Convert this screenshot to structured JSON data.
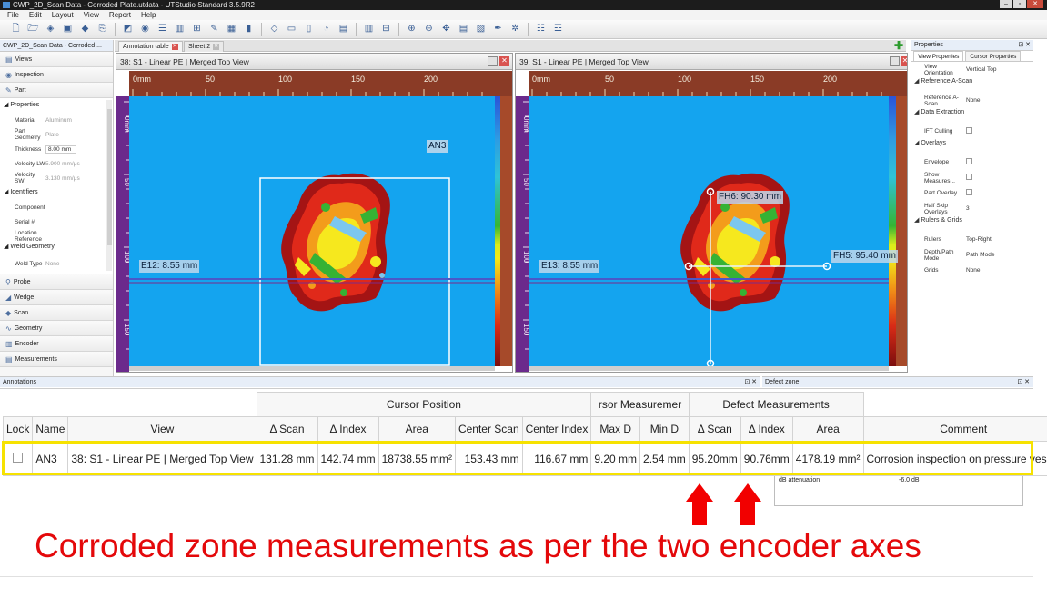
{
  "window": {
    "title": "CWP_2D_Scan Data - Corroded Plate.utdata - UTStudio Standard 3.5.9R2"
  },
  "menu": [
    "File",
    "Edit",
    "Layout",
    "View",
    "Report",
    "Help"
  ],
  "left_panel": {
    "tab": "CWP_2D_Scan Data - Corroded ...",
    "sections_top": [
      "Views",
      "Inspection",
      "Part"
    ],
    "properties_label": "Properties",
    "props": [
      {
        "k": "Material",
        "v": "Aluminum"
      },
      {
        "k": "Part Geometry",
        "v": "Plate"
      },
      {
        "k": "Thickness",
        "v": "8.00 mm"
      },
      {
        "k": "Velocity LW",
        "v": "5.900 mm/μs"
      },
      {
        "k": "Velocity SW",
        "v": "3.130 mm/μs"
      }
    ],
    "identifiers_label": "Identifiers",
    "ident": [
      {
        "k": "Component",
        "v": ""
      },
      {
        "k": "Serial #",
        "v": ""
      },
      {
        "k": "Location Reference",
        "v": ""
      }
    ],
    "weld_label": "Weld Geometry",
    "weld_type": {
      "k": "Weld Type",
      "v": "None"
    },
    "sections_bottom": [
      "Probe",
      "Wedge",
      "Scan",
      "Geometry",
      "Encoder",
      "Measurements"
    ]
  },
  "doc_tabs": [
    "Annotation table",
    "Sheet 2"
  ],
  "views": {
    "left": {
      "title": "38: S1 - Linear PE | Merged Top View",
      "ruler_top": [
        "0mm",
        "50",
        "100",
        "150",
        "200"
      ],
      "ruler_left": [
        "0mm",
        "50",
        "100",
        "150"
      ],
      "annotation": "AN3",
      "cursor_label": "E12: 8.55 mm"
    },
    "right": {
      "title": "39: S1 - Linear PE | Merged Top View",
      "ruler_top": [
        "0mm",
        "50",
        "100",
        "150",
        "200"
      ],
      "ruler_left": [
        "0mm",
        "50",
        "100",
        "150"
      ],
      "cursor_label": "E13: 8.55 mm",
      "fh6": "FH6: 90.30 mm",
      "fh5": "FH5: 95.40 mm"
    }
  },
  "right_panel": {
    "title": "Properties",
    "tabs": [
      "View Properties",
      "Cursor Properties"
    ],
    "rows": [
      {
        "type": "row",
        "k": "View Orientation",
        "v": "Vertical Top"
      },
      {
        "type": "grp",
        "k": "Reference A-Scan"
      },
      {
        "type": "row",
        "k": "Reference A-Scan",
        "v": "None"
      },
      {
        "type": "grp",
        "k": "Data Extraction"
      },
      {
        "type": "chk",
        "k": "IFT Culling"
      },
      {
        "type": "grp",
        "k": "Overlays"
      },
      {
        "type": "chk",
        "k": "Envelope"
      },
      {
        "type": "chk",
        "k": "Show Measures..."
      },
      {
        "type": "chk",
        "k": "Part Overlay"
      },
      {
        "type": "row",
        "k": "Half Skip Overlays",
        "v": "3"
      },
      {
        "type": "grp",
        "k": "Rulers & Grids"
      },
      {
        "type": "row",
        "k": "Rulers",
        "v": "Top-Right"
      },
      {
        "type": "row",
        "k": "Depth/Path Mode",
        "v": "Path Mode"
      },
      {
        "type": "row",
        "k": "Grids",
        "v": "None"
      }
    ]
  },
  "annotations_panel": {
    "title": "Annotations",
    "defect_zone_title": "Defect zone",
    "group_headers": {
      "cursor_position": "Cursor Position",
      "cursor_measurements": "rsor Measuremer",
      "defect_measurements": "Defect Measurements"
    },
    "columns": [
      "Lock",
      "Name",
      "View",
      "Δ Scan",
      "Δ Index",
      "Area",
      "Center Scan",
      "Center Index",
      "Max D",
      "Min D",
      "Δ Scan",
      "Δ Index",
      "Area",
      "Comment"
    ],
    "rows": [
      {
        "lock": false,
        "name": "AN3",
        "view": "38: S1 - Linear PE | Merged Top View",
        "d_scan": "131.28 mm",
        "d_index": "142.74 mm",
        "area": "18738.55 mm²",
        "center_scan": "153.43 mm",
        "center_index": "116.67 mm",
        "max_d": "9.20 mm",
        "min_d": "2.54 mm",
        "defect_d_scan": "95.20mm",
        "defect_d_index": "90.76mm",
        "defect_area": "4178.19 mm²",
        "comment": "Corrosion inspection on pressure vessel"
      }
    ],
    "defect_row": {
      "k": "dB attenuation",
      "v": "-6.0 dB"
    }
  },
  "caption": "Corroded zone measurements as per the two encoder axes",
  "colors": {
    "highlight": "#f6e200",
    "arrow": "#f20000",
    "caption": "#e4080a",
    "cscan_bg": "#14a4ef"
  }
}
